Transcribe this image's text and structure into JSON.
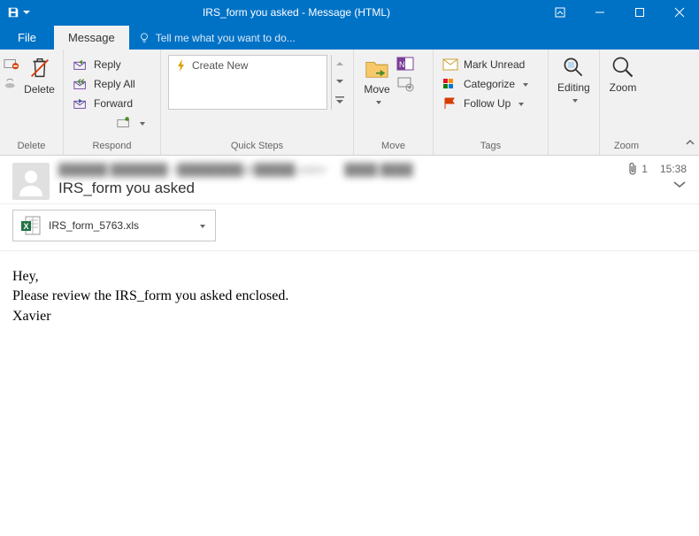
{
  "window": {
    "title": "IRS_form you asked - Message (HTML)"
  },
  "tabs": {
    "file": "File",
    "message": "Message",
    "tellme": "Tell me what you want to do..."
  },
  "ribbon": {
    "delete_group": "Delete",
    "delete": "Delete",
    "respond_group": "Respond",
    "reply": "Reply",
    "reply_all": "Reply All",
    "forward": "Forward",
    "quicksteps_group": "Quick Steps",
    "create_new": "Create New",
    "move_group": "Move",
    "move": "Move",
    "tags_group": "Tags",
    "mark_unread": "Mark Unread",
    "categorize": "Categorize",
    "follow_up": "Follow Up",
    "editing": "Editing",
    "zoom_group": "Zoom",
    "zoom": "Zoom"
  },
  "message": {
    "subject": "IRS_form you asked",
    "attachment_count": "1",
    "time": "15:38",
    "attachment_name": "IRS_form_5763.xls",
    "body": "Hey,\nPlease review the IRS_form you asked enclosed.\nXavier"
  }
}
